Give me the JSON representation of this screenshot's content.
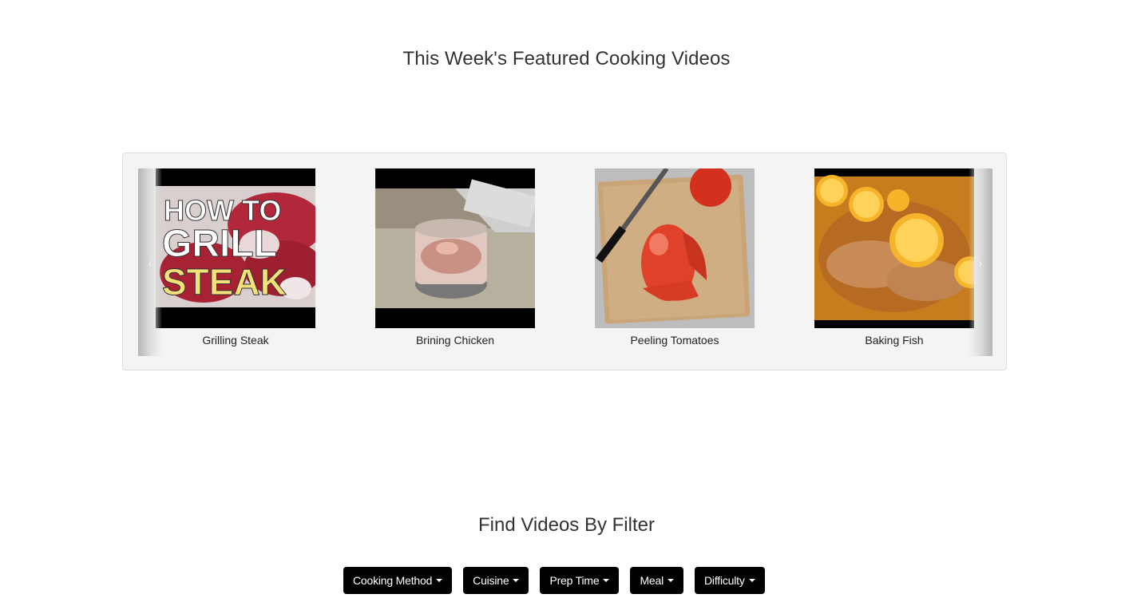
{
  "featured": {
    "title": "This Week's Featured Cooking Videos",
    "prev_glyph": "‹",
    "next_glyph": "›",
    "videos": [
      {
        "caption": "Grilling Steak",
        "thumb_text": [
          "HOW TO",
          "GRILL",
          "STEAK"
        ]
      },
      {
        "caption": "Brining Chicken"
      },
      {
        "caption": "Peeling Tomatoes"
      },
      {
        "caption": "Baking Fish"
      }
    ]
  },
  "filters": {
    "title": "Find Videos By Filter",
    "buttons": [
      {
        "label": "Cooking Method"
      },
      {
        "label": "Cuisine"
      },
      {
        "label": "Prep Time"
      },
      {
        "label": "Meal"
      },
      {
        "label": "Difficulty"
      }
    ]
  }
}
